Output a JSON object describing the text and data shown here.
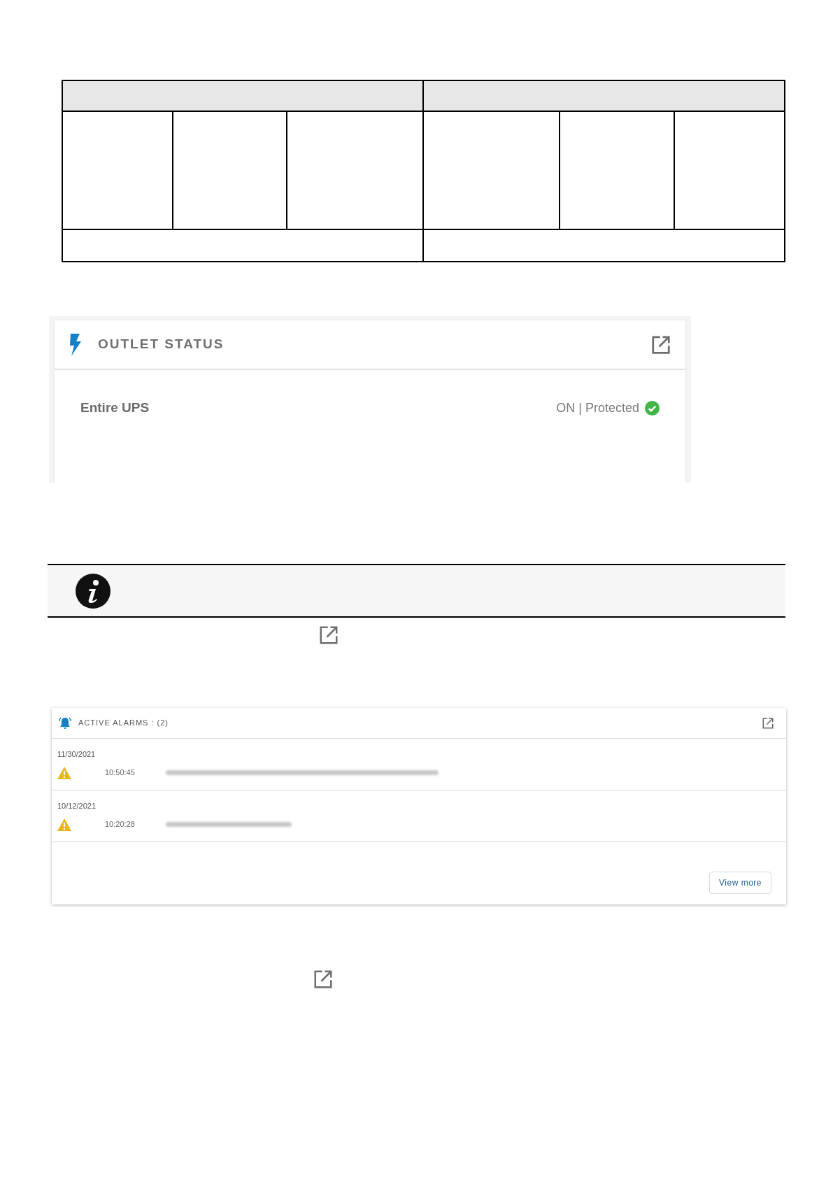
{
  "outlet_status": {
    "title": "OUTLET STATUS",
    "rows": [
      {
        "label": "Entire UPS",
        "status": "ON | Protected",
        "ok": true
      }
    ]
  },
  "active_alarms": {
    "title": "ACTIVE ALARMS : (2)",
    "alarms": [
      {
        "date": "11/30/2021",
        "time": "10:50:45"
      },
      {
        "date": "10/12/2021",
        "time": "10:20:28"
      }
    ],
    "view_more": "View more"
  }
}
